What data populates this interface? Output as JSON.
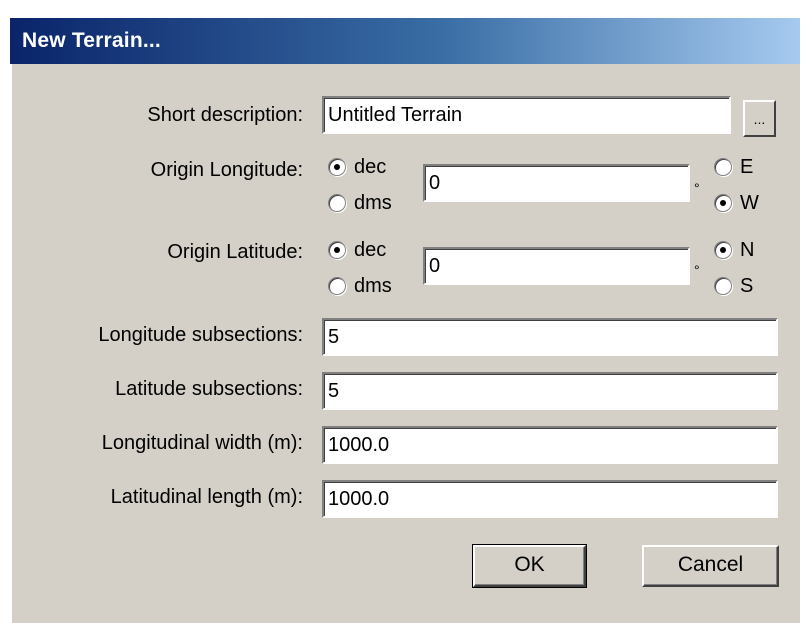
{
  "dialog": {
    "title": "New Terrain...",
    "short_description": {
      "label": "Short description:",
      "value": "Untitled Terrain",
      "browse_label": "..."
    },
    "origin_longitude": {
      "label": "Origin Longitude:",
      "format_options": [
        "dec",
        "dms"
      ],
      "format_selected": "dec",
      "value": "0",
      "degree_symbol": "°",
      "direction_options": [
        "E",
        "W"
      ],
      "direction_selected": "W"
    },
    "origin_latitude": {
      "label": "Origin Latitude:",
      "format_options": [
        "dec",
        "dms"
      ],
      "format_selected": "dec",
      "value": "0",
      "degree_symbol": "°",
      "direction_options": [
        "N",
        "S"
      ],
      "direction_selected": "N"
    },
    "longitude_subsections": {
      "label": "Longitude subsections:",
      "value": "5"
    },
    "latitude_subsections": {
      "label": "Latitude subsections:",
      "value": "5"
    },
    "longitudinal_width": {
      "label": "Longitudinal width (m):",
      "value": "1000.0"
    },
    "latitudinal_length": {
      "label": "Latitudinal length (m):",
      "value": "1000.0"
    },
    "ok_label": "OK",
    "cancel_label": "Cancel"
  }
}
